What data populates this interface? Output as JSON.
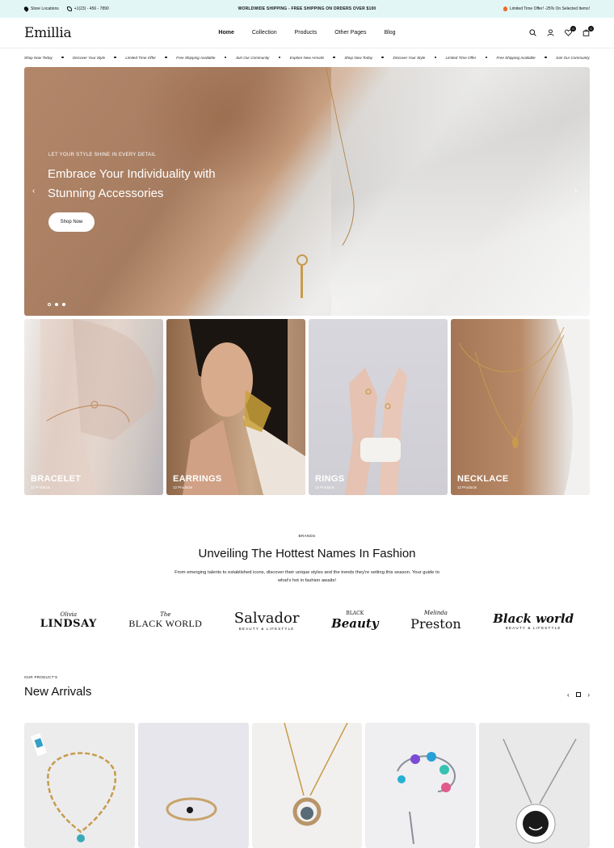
{
  "topbar": {
    "store": "Store Locations",
    "phone": "+1(23) - 456 - 7890",
    "shipping": "WORLDWIDE SHIPPING - FREE SHIPPING ON ORDERS OVER $100",
    "offer": "Limited Time Offer! -25% On Selected Items!"
  },
  "header": {
    "logo": "Emillia",
    "nav": [
      "Home",
      "Collection",
      "Products",
      "Other Pages",
      "Blog"
    ],
    "wishlist_count": "0",
    "cart_count": "0"
  },
  "marquee": [
    "Shop Now Today",
    "Discover Your Style",
    "Limited Time Offer",
    "Free Shipping Available",
    "Join Our Community",
    "Explore New Arrivals",
    "Shop Now Today",
    "Discover Your Style",
    "Limited Time Offer",
    "Free Shipping Available",
    "Join Our Community"
  ],
  "hero": {
    "kicker": "LET YOUR STYLE SHINE IN EVERY DETAIL",
    "headline": "Embrace Your Individuality with Stunning Accessories",
    "cta": "Shop Now",
    "prev": "‹",
    "next": "›",
    "slides": 3,
    "active_slide": 1
  },
  "categories": [
    {
      "label": "BRACELET",
      "count": "12 Products"
    },
    {
      "label": "EARRINGS",
      "count": "12 Products"
    },
    {
      "label": "RINGS",
      "count": "12 Products"
    },
    {
      "label": "NECKLACE",
      "count": "12 Products"
    }
  ],
  "brands": {
    "kicker": "BRANDS",
    "title": "Unveiling The Hottest Names In Fashion",
    "description": "From emerging talents to established icons, discover their unique styles and the trends they're setting this season. Your guide to what's hot in fashion awaits!",
    "logos": [
      {
        "script": "Olivia",
        "main": "LINDSAY",
        "tag": ""
      },
      {
        "script": "The",
        "main": "BLACK WORLD",
        "tag": ""
      },
      {
        "script": "",
        "main": "Salvador",
        "tag": "BEAUTY & LIFESTYLE"
      },
      {
        "script": "BLACK",
        "main": "Beauty",
        "tag": ""
      },
      {
        "script": "Melinda",
        "main": "Preston",
        "tag": ""
      },
      {
        "script": "",
        "main": "Black world",
        "tag": "BEAUTY & LIFESTYLE"
      }
    ]
  },
  "new_arrivals": {
    "kicker": "OUR PRODUCT'S",
    "title": "New Arrivals",
    "prev": "‹",
    "next": "›"
  },
  "colors": {
    "topbar_bg": "#e3f6f6",
    "accent_gold": "#c79b4b",
    "text": "#111111"
  }
}
